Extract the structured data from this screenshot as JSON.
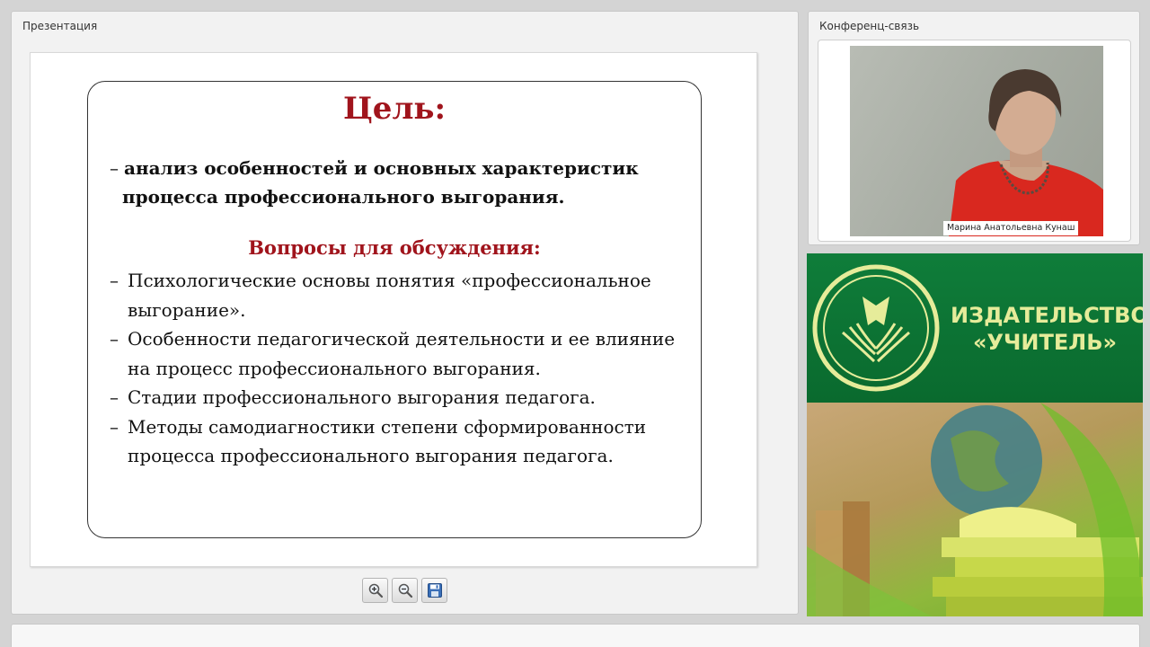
{
  "presentation_panel": {
    "title": "Презентация"
  },
  "slide": {
    "title": "Цель:",
    "goal_dash": "–",
    "goal_line1": "анализ особенностей и основных характеристик",
    "goal_line2": "процесса профессионального выгорания.",
    "questions_heading": "Вопросы для обсуждения:",
    "questions": [
      "Психологические основы понятия «профессиональное выгорание».",
      "Особенности педагогической деятельности и ее влияние на процесс профессионального выгорания.",
      "Стадии профессионального выгорания педагога.",
      "Методы самодиагностики степени сформированности процесса профессионального выгорания педагога."
    ]
  },
  "toolbar": {
    "zoom_in_icon": "zoom-in-icon",
    "zoom_out_icon": "zoom-out-icon",
    "save_icon": "save-icon"
  },
  "conference_panel": {
    "title": "Конференц-связь",
    "participant_name": "Марина Анатольевна Кунаш"
  },
  "advertisement": {
    "publisher_line1": "ИЗДАТЕЛЬСТВО",
    "publisher_line2": "«УЧИТЕЛЬ»",
    "brand_green": "#0a6a2e",
    "brand_yellow": "#e6ec9a"
  }
}
